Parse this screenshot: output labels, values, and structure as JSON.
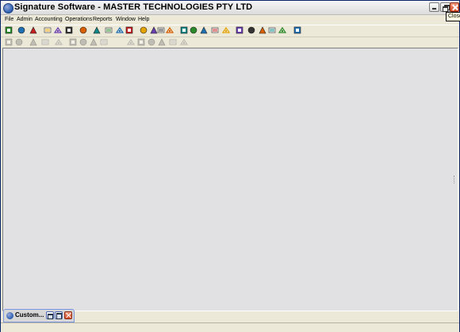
{
  "window": {
    "title": "Signature Software - MASTER TECHNOLOGIES PTY LTD",
    "tooltip": "Close"
  },
  "menu": [
    "File",
    "Admin",
    "Accounting",
    "Operations",
    "Reports",
    "Window",
    "Help"
  ],
  "toolbar1": [
    "running-man-icon",
    "exit-door-icon",
    "calculator-icon",
    "book-icon",
    "red-arrows-icon",
    "checkmark-document-icon",
    "people-icon",
    "truck-icon",
    "phone-icon",
    "pen-icon",
    "moon-icon",
    "pencil-edit-icon",
    "ie-icon",
    "lightning-icon",
    "exclamation-icon",
    "bar-chart-icon",
    "book-stack-icon",
    "wrench-people-icon",
    "sparkle-icon",
    "refresh-icon",
    "eraser-icon",
    "check-box-icon",
    "printer-icon",
    "copy-window-icon",
    "stamp-icon",
    "calendar-icon"
  ],
  "toolbar2": [
    "warning-icon",
    "add-warning-icon",
    "print-icon",
    "eraser-icon",
    "up-arrow-icon",
    "first-record-icon",
    "prev-record-icon",
    "next-record-icon",
    "last-record-icon",
    "add-record-icon",
    "edit-record-icon",
    "delete-record-icon",
    "save-record-icon",
    "cancel-record-icon",
    "refresh-record-icon"
  ],
  "minimized_child": {
    "title": "Custom..."
  }
}
